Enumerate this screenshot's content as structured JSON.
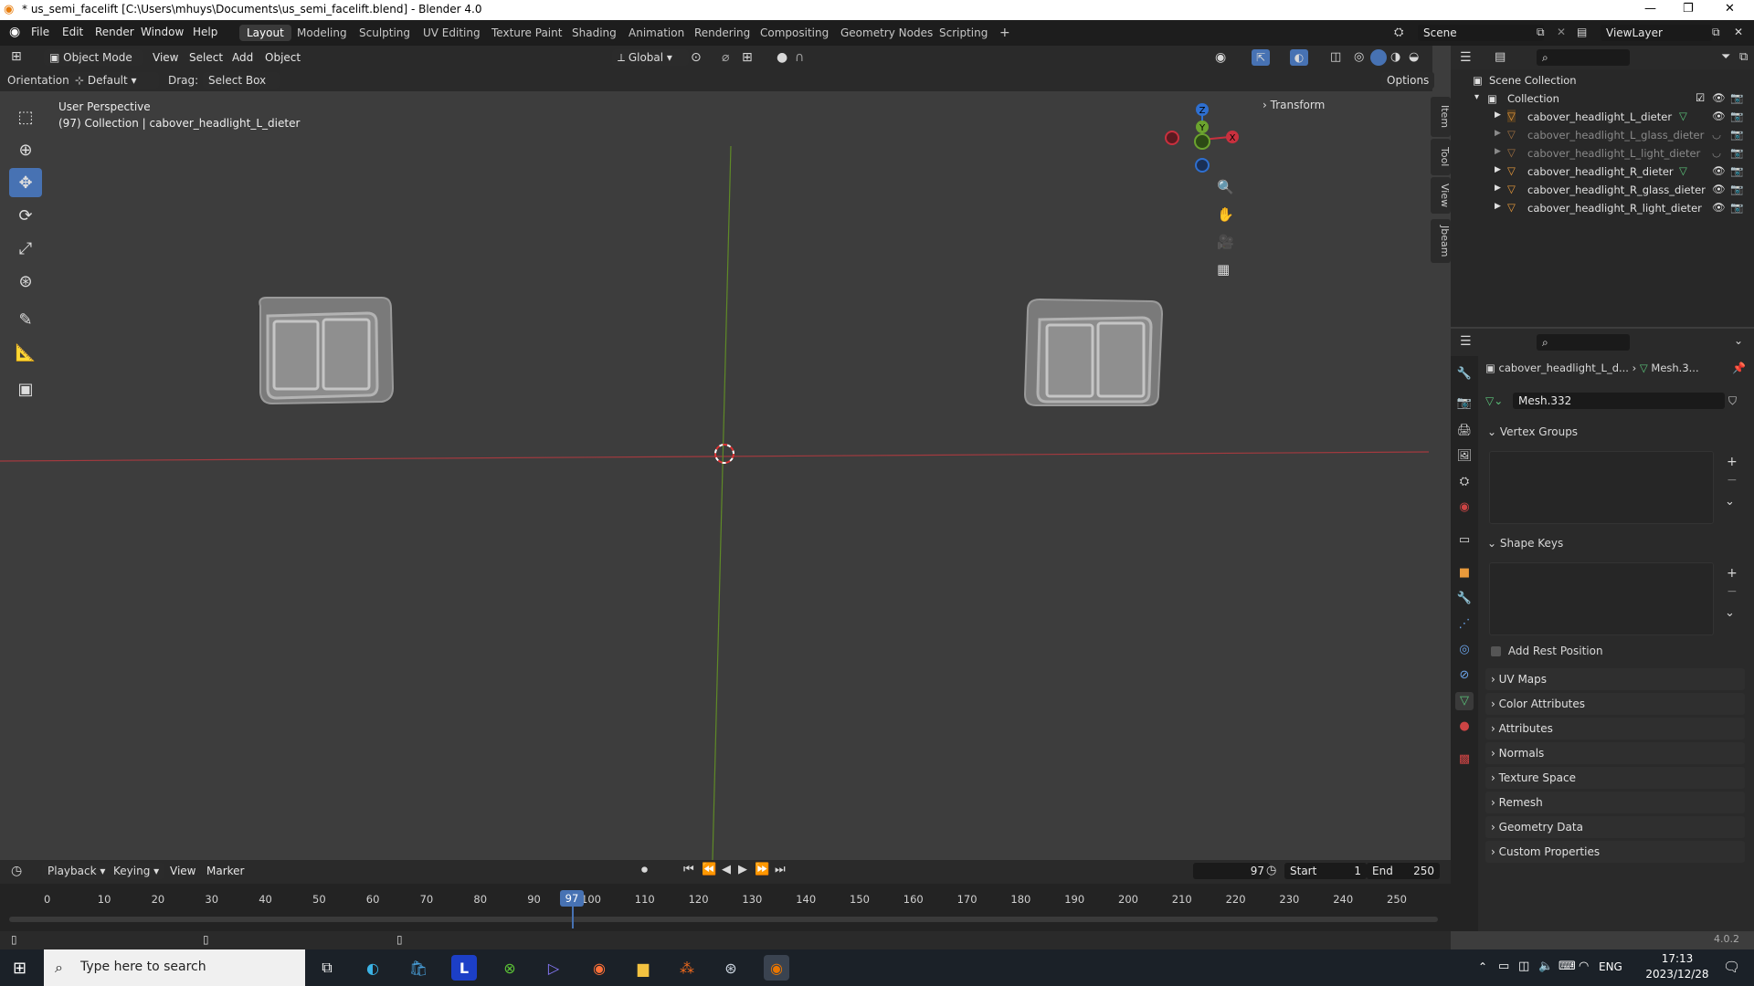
{
  "window": {
    "title": "* us_semi_facelift [C:\\Users\\mhuys\\Documents\\us_semi_facelift.blend] - Blender 4.0",
    "minimize": "—",
    "maximize": "❐",
    "close": "✕"
  },
  "menu": [
    "File",
    "Edit",
    "Render",
    "Window",
    "Help"
  ],
  "workspaces": [
    "Layout",
    "Modeling",
    "Sculpting",
    "UV Editing",
    "Texture Paint",
    "Shading",
    "Animation",
    "Rendering",
    "Compositing",
    "Geometry Nodes",
    "Scripting"
  ],
  "workspace_add": "+",
  "scene": {
    "label": "Scene",
    "viewlayer": "ViewLayer"
  },
  "viewport_header": {
    "mode": "Object Mode",
    "menus": [
      "View",
      "Select",
      "Add",
      "Object"
    ],
    "transform_space": "Global",
    "orientation_label": "Orientation:",
    "orientation_value": "Default",
    "drag_label": "Drag:",
    "drag_value": "Select Box",
    "options": "Options"
  },
  "viewport": {
    "perspective": "User Perspective",
    "collection_info": "(97) Collection | cabover_headlight_L_dieter",
    "transform_panel": "Transform",
    "side_tabs": [
      "Item",
      "Tool",
      "View",
      "Jbeam"
    ],
    "gizmo_axes": [
      "Z",
      "Y",
      "X"
    ]
  },
  "outliner": {
    "root": "Scene Collection",
    "collection": "Collection",
    "items": [
      {
        "name": "cabover_headlight_L_dieter",
        "dim": false,
        "mesh_icon": true
      },
      {
        "name": "cabover_headlight_L_glass_dieter",
        "dim": true,
        "mesh_icon": false
      },
      {
        "name": "cabover_headlight_L_light_dieter",
        "dim": true,
        "mesh_icon": false
      },
      {
        "name": "cabover_headlight_R_dieter",
        "dim": false,
        "mesh_icon": true
      },
      {
        "name": "cabover_headlight_R_glass_dieter",
        "dim": false,
        "mesh_icon": false
      },
      {
        "name": "cabover_headlight_R_light_dieter",
        "dim": false,
        "mesh_icon": false
      }
    ]
  },
  "properties": {
    "breadcrumb_object": "cabover_headlight_L_d...",
    "breadcrumb_mesh": "Mesh.3...",
    "mesh_name": "Mesh.332",
    "vertex_groups": "Vertex Groups",
    "shape_keys": "Shape Keys",
    "add_rest_position": "Add Rest Position",
    "panels": [
      "UV Maps",
      "Color Attributes",
      "Attributes",
      "Normals",
      "Texture Space",
      "Remesh",
      "Geometry Data",
      "Custom Properties"
    ]
  },
  "timeline": {
    "menus": [
      "Playback",
      "Keying",
      "View",
      "Marker"
    ],
    "current_frame": "97",
    "start_label": "Start",
    "start": "1",
    "end_label": "End",
    "end": "250",
    "ticks": [
      "0",
      "10",
      "20",
      "30",
      "40",
      "50",
      "60",
      "70",
      "80",
      "90",
      "100",
      "110",
      "120",
      "130",
      "140",
      "150",
      "160",
      "170",
      "180",
      "190",
      "200",
      "210",
      "220",
      "230",
      "240",
      "250"
    ],
    "version": "4.0.2"
  },
  "taskbar": {
    "search_placeholder": "Type here to search",
    "lang": "ENG",
    "time": "17:13",
    "date": "2023/12/28"
  },
  "colors": {
    "accent": "#4772b3",
    "x_axis": "#c9303e",
    "y_axis": "#6ba32e",
    "z_axis": "#2e6fd0"
  }
}
